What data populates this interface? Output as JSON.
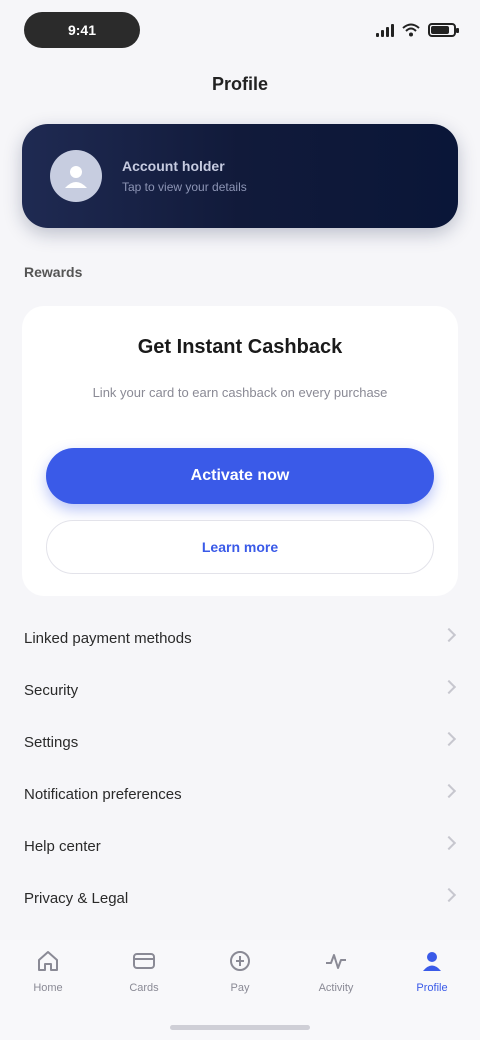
{
  "status_bar": {
    "time": "9:41",
    "battery_level": 0.8
  },
  "header": {
    "title": "Profile"
  },
  "account": {
    "name": "Account holder",
    "subtitle": "Tap to view your details",
    "avatar_icon": "user-icon"
  },
  "section": {
    "label": "Rewards"
  },
  "promo": {
    "title": "Get Instant Cashback",
    "subtitle": "Link your card to earn cashback on every purchase",
    "primary_label": "Activate now",
    "secondary_label": "Learn more"
  },
  "menu": {
    "items": [
      {
        "label": "Linked payment methods"
      },
      {
        "label": "Security"
      },
      {
        "label": "Settings"
      },
      {
        "label": "Notification preferences"
      },
      {
        "label": "Help center"
      },
      {
        "label": "Privacy & Legal"
      }
    ]
  },
  "tabs": [
    {
      "label": "Home",
      "icon": "home-icon"
    },
    {
      "label": "Cards",
      "icon": "card-icon"
    },
    {
      "label": "Pay",
      "icon": "pay-icon"
    },
    {
      "label": "Activity",
      "icon": "activity-icon"
    },
    {
      "label": "Profile",
      "icon": "profile-icon",
      "active": true
    }
  ],
  "colors": {
    "accent": "#3a5ae8",
    "card_dark": "#0a1638",
    "background": "#f6f6f9"
  }
}
